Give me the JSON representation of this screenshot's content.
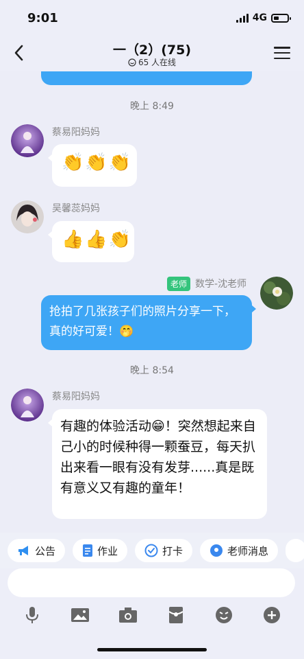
{
  "status": {
    "time": "9:01",
    "network": "4G"
  },
  "header": {
    "title": "一（2）(75)",
    "online": "65 人在线"
  },
  "messages": [
    {
      "type": "time",
      "text": "晚上 8:49"
    },
    {
      "type": "received",
      "sender": "蔡易阳妈妈",
      "content": "👏👏👏"
    },
    {
      "type": "received",
      "sender": "吴馨蕊妈妈",
      "content": "👍👍👏"
    },
    {
      "type": "sent",
      "tag": "老师",
      "sender": "数学-沈老师",
      "content": "抢拍了几张孩子们的照片分享一下，真的好可爱！🤭"
    },
    {
      "type": "time",
      "text": "晚上 8:54"
    },
    {
      "type": "received",
      "sender": "蔡易阳妈妈",
      "content": "有趣的体验活动😁！突然想起来自己小的时候种得一颗蚕豆，每天扒出来看一眼有没有发芽......真是既有意义又有趣的童年！"
    }
  ],
  "shortcuts": [
    {
      "label": "公告",
      "icon": "megaphone-icon",
      "color": "#2f8ff0"
    },
    {
      "label": "作业",
      "icon": "document-icon",
      "color": "#3a88ee"
    },
    {
      "label": "打卡",
      "icon": "check-circle-icon",
      "color": "#3a88ee"
    },
    {
      "label": "老师消息",
      "icon": "teacher-message-icon",
      "color": "#3a88ee"
    }
  ],
  "input": {
    "placeholder": ""
  },
  "toolbar": [
    "microphone-icon",
    "image-icon",
    "camera-icon",
    "red-packet-icon",
    "emoji-icon",
    "plus-icon"
  ],
  "colors": {
    "accent": "#3ea6f5",
    "teacher_tag": "#34c47c",
    "background": "#edeef8"
  }
}
